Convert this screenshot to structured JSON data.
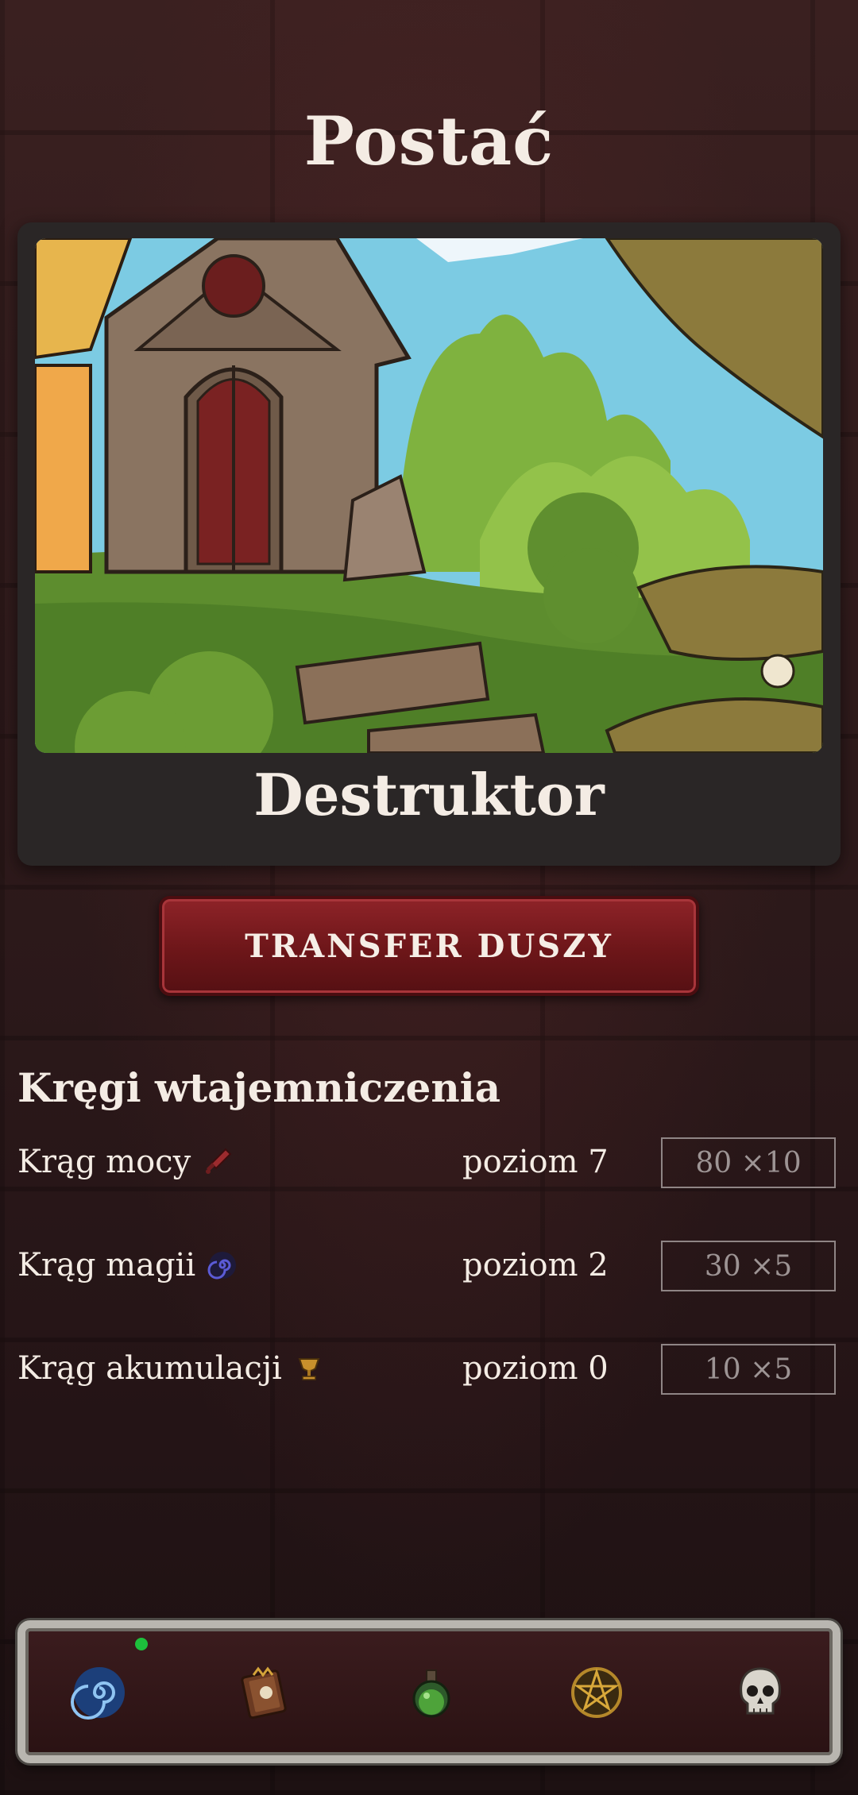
{
  "header": {
    "title": "Postać"
  },
  "hero": {
    "name": "Destruktor"
  },
  "actions": {
    "transfer_label": "TRANSFER DUSZY"
  },
  "circles": {
    "title": "Kręgi wtajemniczenia",
    "items": [
      {
        "name": "Krąg mocy",
        "icon": "sword-icon",
        "level": "poziom 7",
        "cost": "80 ×10"
      },
      {
        "name": "Krąg magii",
        "icon": "spiral-icon",
        "level": "poziom 2",
        "cost": "30 ×5"
      },
      {
        "name": "Krąg akumulacji",
        "icon": "chalice-icon",
        "level": "poziom 0",
        "cost": "10 ×5"
      }
    ]
  },
  "nav": {
    "items": [
      {
        "icon": "portal-vortex-icon",
        "active_indicator": true
      },
      {
        "icon": "spellbook-icon",
        "active_indicator": false
      },
      {
        "icon": "potion-icon",
        "active_indicator": false
      },
      {
        "icon": "pentagram-icon",
        "active_indicator": false
      },
      {
        "icon": "skull-icon",
        "active_indicator": false
      }
    ]
  },
  "colors": {
    "background": "#2a1718",
    "card": "#2a2626",
    "button": "#7a1b1f",
    "text": "#f4ece4",
    "cost_text": "#9d9494",
    "indicator": "#1dbf3c"
  }
}
